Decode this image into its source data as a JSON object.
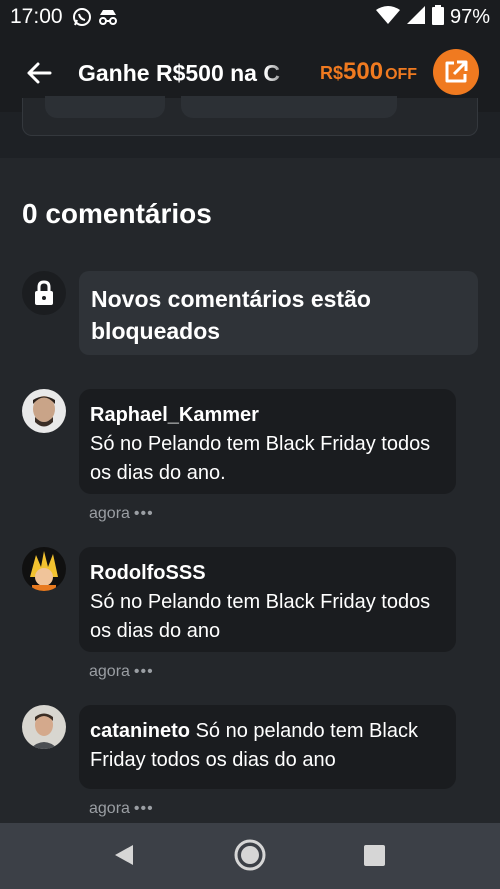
{
  "status_bar": {
    "time": "17:00",
    "icons": [
      "whatsapp-icon",
      "incognito-icon"
    ],
    "battery_percent": "97%"
  },
  "app_bar": {
    "title": "Ganhe R$500 na C",
    "price_currency": "R$",
    "price_value": "500",
    "price_suffix": "OFF",
    "accent_color": "#f07a20"
  },
  "comments": {
    "heading": "0 comentários",
    "locked_notice": "Novos comentários estão bloqueados",
    "items": [
      {
        "user": "Raphael_Kammer",
        "text": "Só no Pelando tem Black Friday todos os dias do ano.",
        "time": "agora",
        "more": "•••"
      },
      {
        "user": "RodolfoSSS",
        "text": "Só no Pelando tem Black Friday todos os dias do ano",
        "time": "agora",
        "more": "•••"
      },
      {
        "user": "catanineto",
        "text": "Só no pelando tem Black Friday todos os dias do ano",
        "time": "agora",
        "more": "•••"
      }
    ]
  }
}
